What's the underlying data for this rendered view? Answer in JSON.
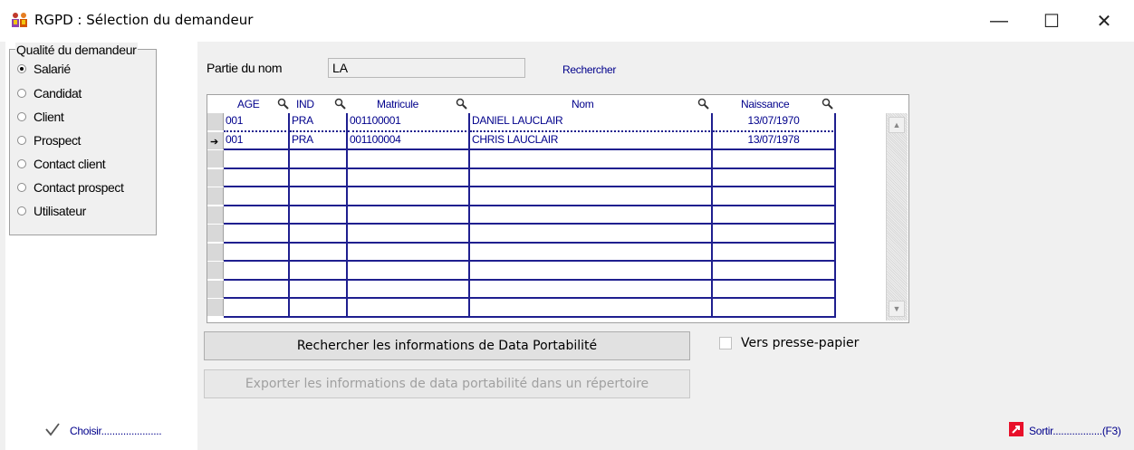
{
  "window": {
    "title": "RGPD : Sélection du demandeur",
    "minimize": "—",
    "maximize": "☐",
    "close": "✕"
  },
  "group": {
    "legend": "Qualité du demandeur",
    "options": [
      "Salarié",
      "Candidat",
      "Client",
      "Prospect",
      "Contact client",
      "Contact prospect",
      "Utilisateur"
    ],
    "selected": "Salarié"
  },
  "search": {
    "label": "Partie du nom",
    "value": "LA",
    "button": "Rechercher"
  },
  "grid": {
    "headers": [
      "AGE",
      "IND",
      "Matricule",
      "Nom",
      "Naissance"
    ],
    "rows": [
      [
        "001",
        "PRA",
        "001100001",
        "DANIEL LAUCLAIR",
        "13/07/1970"
      ],
      [
        "001",
        "PRA",
        "001100004",
        "CHRIS LAUCLAIR",
        "13/07/1978"
      ]
    ],
    "current_row_marker": "➔"
  },
  "actions": {
    "search_portability": "Rechercher les informations de Data Portabilité",
    "export_portability": "Exporter les informations de data portabilité dans un répertoire",
    "clipboard": "Vers presse-papier"
  },
  "footer": {
    "choose": "Choisir......................",
    "exit": "Sortir..................(F3)"
  },
  "colors": {
    "link": "#00008b",
    "grid_line": "#1f1f8f",
    "background": "#f0f0f0",
    "exit_icon": "#e8102a"
  }
}
